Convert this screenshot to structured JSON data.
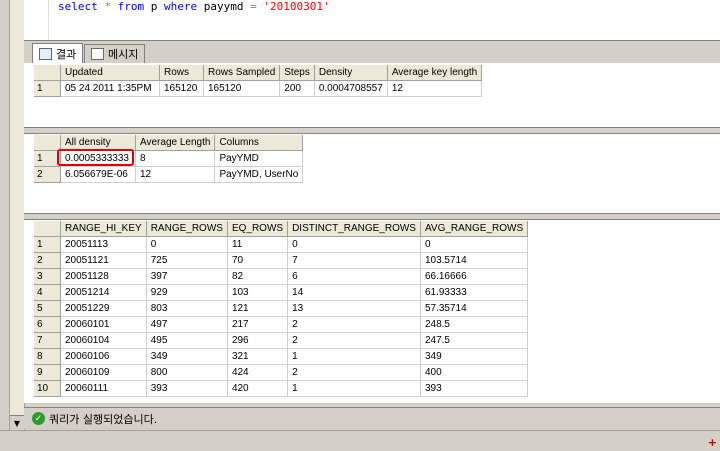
{
  "editor": {
    "query_parts": {
      "kw1": "select",
      "star": "*",
      "kw2": "from",
      "table": "p",
      "kw3": "where",
      "column": "payymd",
      "eq": "=",
      "value": "'20100301'"
    }
  },
  "tabs": [
    {
      "label": "결과",
      "icon": "grid-icon"
    },
    {
      "label": "메시지",
      "icon": "message-icon"
    }
  ],
  "header_grid": {
    "columns": [
      "Updated",
      "Rows",
      "Rows Sampled",
      "Steps",
      "Density",
      "Average key length"
    ],
    "rows": [
      {
        "n": "1",
        "cells": [
          "05 24 2011  1:35PM",
          "165120",
          "165120",
          "200",
          "0.0004708557",
          "12"
        ]
      }
    ]
  },
  "density_grid": {
    "columns": [
      "All density",
      "Average Length",
      "Columns"
    ],
    "rows": [
      {
        "n": "1",
        "cells": [
          "0.0005333333",
          "8",
          "PayYMD"
        ]
      },
      {
        "n": "2",
        "cells": [
          "6.056679E-06",
          "12",
          "PayYMD, UserNo"
        ]
      }
    ]
  },
  "histogram_grid": {
    "columns": [
      "RANGE_HI_KEY",
      "RANGE_ROWS",
      "EQ_ROWS",
      "DISTINCT_RANGE_ROWS",
      "AVG_RANGE_ROWS"
    ],
    "rows": [
      {
        "n": "1",
        "cells": [
          "20051113",
          "0",
          "11",
          "0",
          "0"
        ]
      },
      {
        "n": "2",
        "cells": [
          "20051121",
          "725",
          "70",
          "7",
          "103.5714"
        ]
      },
      {
        "n": "3",
        "cells": [
          "20051128",
          "397",
          "82",
          "6",
          "66.16666"
        ]
      },
      {
        "n": "4",
        "cells": [
          "20051214",
          "929",
          "103",
          "14",
          "61.93333"
        ]
      },
      {
        "n": "5",
        "cells": [
          "20051229",
          "803",
          "121",
          "13",
          "57.35714"
        ]
      },
      {
        "n": "6",
        "cells": [
          "20060101",
          "497",
          "217",
          "2",
          "248.5"
        ]
      },
      {
        "n": "7",
        "cells": [
          "20060104",
          "495",
          "296",
          "2",
          "247.5"
        ]
      },
      {
        "n": "8",
        "cells": [
          "20060106",
          "349",
          "321",
          "1",
          "349"
        ]
      },
      {
        "n": "9",
        "cells": [
          "20060109",
          "800",
          "424",
          "2",
          "400"
        ]
      },
      {
        "n": "10",
        "cells": [
          "20060111",
          "393",
          "420",
          "1",
          "393"
        ]
      }
    ]
  },
  "status": {
    "message": "쿼리가 실행되었습니다.",
    "icon": "check-circle-icon",
    "icon_color": "#2e9a2e"
  },
  "annotation": {
    "color": "#e00000"
  }
}
